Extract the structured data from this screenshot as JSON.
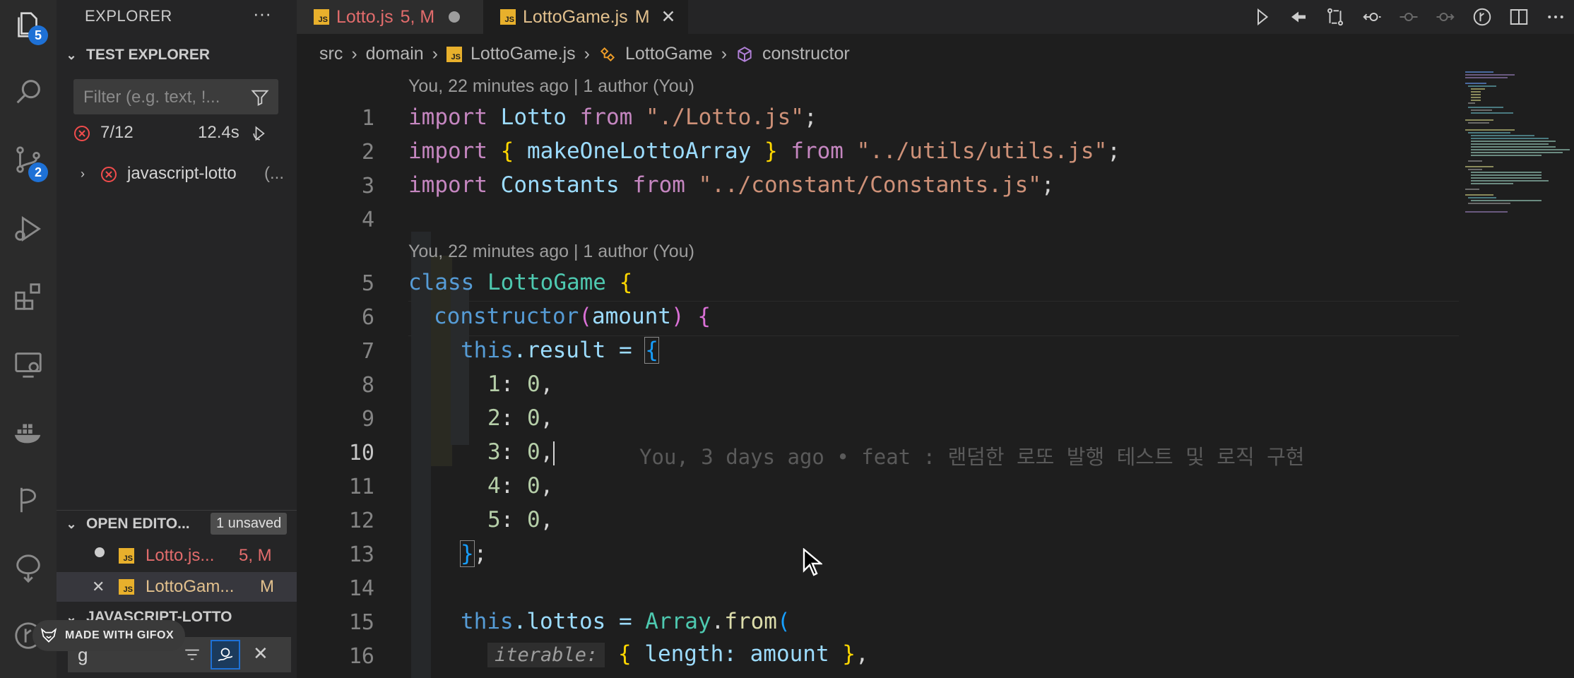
{
  "activity_bar": {
    "explorer_badge": "5",
    "scm_badge": "2"
  },
  "sidebar": {
    "title": "EXPLORER",
    "more": "···",
    "test_explorer": {
      "header": "TEST EXPLORER",
      "filter_placeholder": "Filter (e.g. text, !...",
      "summary_count": "7/12",
      "summary_time": "12.4s",
      "tree_item": "javascript-lotto",
      "tree_item_suffix": "(..."
    },
    "open_editors": {
      "header": "OPEN EDITO...",
      "unsaved_badge": "1 unsaved",
      "items": [
        {
          "name": "Lotto.js...",
          "status": "5, M"
        },
        {
          "name": "LottoGam...",
          "status": "M"
        }
      ]
    },
    "project_header": "JAVASCRIPT-LOTTO",
    "find_value": "g"
  },
  "tabs": [
    {
      "name": "Lotto.js",
      "status": "5, M"
    },
    {
      "name": "LottoGame.js",
      "status": "M"
    }
  ],
  "breadcrumb": {
    "items": [
      "src",
      "domain",
      "LottoGame.js",
      "LottoGame",
      "constructor"
    ]
  },
  "editor": {
    "codelens_1": "You, 22 minutes ago | 1 author (You)",
    "codelens_2": "You, 22 minutes ago | 1 author (You)",
    "line_numbers": [
      "1",
      "2",
      "3",
      "4",
      "5",
      "6",
      "7",
      "8",
      "9",
      "10",
      "11",
      "12",
      "13",
      "14",
      "15",
      "16"
    ],
    "current_line": "10",
    "blame": "You, 3 days ago • feat : 랜덤한 로또 발행 테스트 및 로직 구현",
    "inlay_hint": "iterable:",
    "code": {
      "l1": {
        "a": "import",
        "b": "Lotto",
        "c": "from",
        "d": "\"./Lotto.js\"",
        "e": ";"
      },
      "l2": {
        "a": "import",
        "b": "{",
        "c": "makeOneLottoArray",
        "d": "}",
        "e": "from",
        "f": "\"../utils/utils.js\"",
        "g": ";"
      },
      "l3": {
        "a": "import",
        "b": "Constants",
        "c": "from",
        "d": "\"../constant/Constants.js\"",
        "e": ";"
      },
      "l5": {
        "a": "class",
        "b": "LottoGame",
        "c": "{"
      },
      "l6": {
        "a": "constructor",
        "b": "(",
        "c": "amount",
        "d": ")",
        "e": "{"
      },
      "l7": {
        "a": "this",
        "b": ".result = ",
        "c": "{"
      },
      "l8": {
        "a": "1",
        "b": ": ",
        "c": "0",
        "d": ","
      },
      "l9": {
        "a": "2",
        "b": ": ",
        "c": "0",
        "d": ","
      },
      "l10": {
        "a": "3",
        "b": ": ",
        "c": "0",
        "d": ","
      },
      "l11": {
        "a": "4",
        "b": ": ",
        "c": "0",
        "d": ","
      },
      "l12": {
        "a": "5",
        "b": ": ",
        "c": "0",
        "d": ","
      },
      "l13": {
        "a": "}",
        "b": ";"
      },
      "l15": {
        "a": "this",
        "b": ".lottos = ",
        "c": "Array",
        "d": ".",
        "e": "from",
        "f": "("
      },
      "l16": {
        "a": "{",
        "b": " length: ",
        "c": "amount",
        "d": " ",
        "e": "}",
        "f": ","
      }
    }
  },
  "watermark": "MADE WITH GIFOX",
  "colors": {
    "accent": "#1e71d6",
    "modified": "#e2c08d",
    "error": "#f14c4c",
    "tab_modified_red": "#e26c6c"
  }
}
